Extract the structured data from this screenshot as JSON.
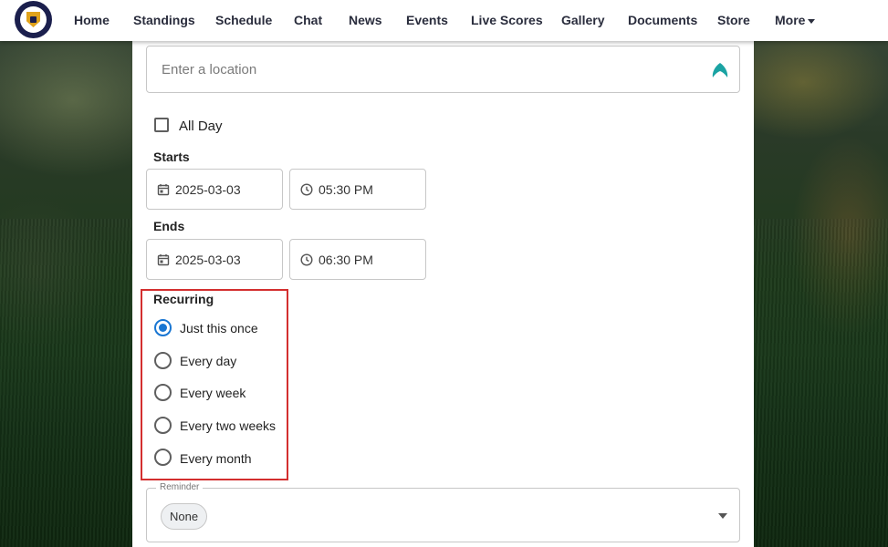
{
  "nav": {
    "items": [
      {
        "label": "Home"
      },
      {
        "label": "Standings"
      },
      {
        "label": "Schedule"
      },
      {
        "label": "Chat"
      },
      {
        "label": "News"
      },
      {
        "label": "Events"
      },
      {
        "label": "Live Scores"
      },
      {
        "label": "Gallery"
      },
      {
        "label": "Documents"
      },
      {
        "label": "Store"
      },
      {
        "label": "More"
      }
    ]
  },
  "location": {
    "placeholder": "Enter a location",
    "icon": "navigation-icon"
  },
  "all_day": {
    "label": "All Day",
    "checked": false
  },
  "starts": {
    "label": "Starts",
    "date": "2025-03-03",
    "time": "05:30 PM"
  },
  "ends": {
    "label": "Ends",
    "date": "2025-03-03",
    "time": "06:30 PM"
  },
  "recurring": {
    "label": "Recurring",
    "options": [
      {
        "label": "Just this once",
        "selected": true
      },
      {
        "label": "Every day",
        "selected": false
      },
      {
        "label": "Every week",
        "selected": false
      },
      {
        "label": "Every two weeks",
        "selected": false
      },
      {
        "label": "Every month",
        "selected": false
      }
    ]
  },
  "reminder": {
    "label": "Reminder",
    "value": "None"
  },
  "colors": {
    "accent": "#1976d2",
    "highlight": "#d32f2f",
    "nav_text": "#2a2d3d",
    "logo": "#1b1f4d"
  }
}
